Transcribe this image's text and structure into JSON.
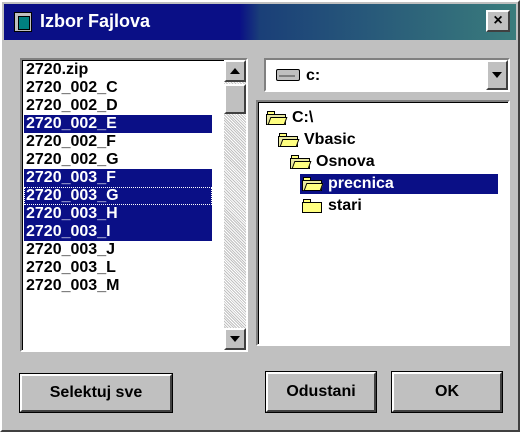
{
  "window": {
    "title": "Izbor Fajlova",
    "close_glyph": "×",
    "icon": "window-app-icon"
  },
  "file_list": {
    "items": [
      {
        "label": "2720.zip",
        "selected": false
      },
      {
        "label": "2720_002_C",
        "selected": false
      },
      {
        "label": "2720_002_D",
        "selected": false
      },
      {
        "label": "2720_002_E",
        "selected": true
      },
      {
        "label": "2720_002_F",
        "selected": false
      },
      {
        "label": "2720_002_G",
        "selected": false
      },
      {
        "label": "2720_003_F",
        "selected": true
      },
      {
        "label": "2720_003_G",
        "selected": true,
        "focused": true
      },
      {
        "label": "2720_003_H",
        "selected": true
      },
      {
        "label": "2720_003_I",
        "selected": true
      },
      {
        "label": "2720_003_J",
        "selected": false
      },
      {
        "label": "2720_003_L",
        "selected": false
      },
      {
        "label": "2720_003_M",
        "selected": false
      }
    ]
  },
  "drive": {
    "value": "c:",
    "icon": "hard-drive-icon"
  },
  "dir_tree": {
    "items": [
      {
        "label": "C:\\",
        "level": 0,
        "open": true,
        "selected": false
      },
      {
        "label": "Vbasic",
        "level": 1,
        "open": true,
        "selected": false
      },
      {
        "label": "Osnova",
        "level": 2,
        "open": true,
        "selected": false
      },
      {
        "label": "precnica",
        "level": 3,
        "open": true,
        "selected": true
      },
      {
        "label": "stari",
        "level": 3,
        "open": false,
        "selected": false
      }
    ]
  },
  "buttons": {
    "select_all": "Selektuj sve",
    "cancel": "Odustani",
    "ok": "OK"
  },
  "colors": {
    "selection": "#0a0f86",
    "face": "#c0c0c0",
    "folder": "#ffff80"
  }
}
